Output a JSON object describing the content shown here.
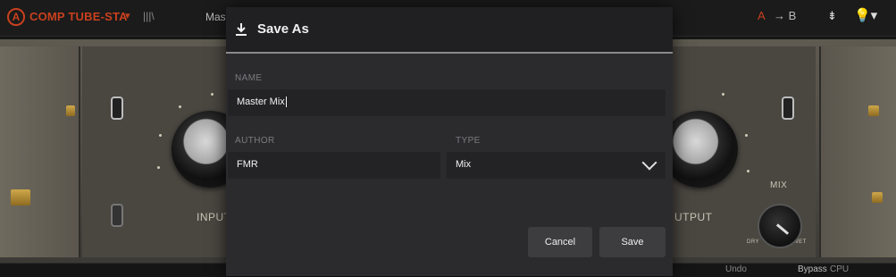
{
  "topbar": {
    "logo_letter": "A",
    "product": "COMP TUBE-STA",
    "product_caret": "▾",
    "bars": "|||\\",
    "preset_fragment": "Maste",
    "right_a": "A",
    "right_b": "→ B",
    "right_c": "⇟",
    "right_d": "💡▾"
  },
  "plugin": {
    "input_label": "INPUT",
    "output_label": "UTPUT",
    "mix_label": "MIX",
    "mix_dry": "DRY",
    "mix_wet": "WET"
  },
  "bottombar": {
    "undo": "Undo",
    "bypass": "Bypass",
    "cpu": "CPU"
  },
  "dialog": {
    "title": "Save As",
    "name_label": "NAME",
    "name_value": "Master Mix",
    "author_label": "AUTHOR",
    "author_value": "FMR",
    "type_label": "TYPE",
    "type_value": "Mix",
    "cancel_label": "Cancel",
    "save_label": "Save"
  },
  "colors": {
    "accent": "#c8401e",
    "dialog_bg": "#2b2b2d",
    "field_bg": "#232325"
  }
}
